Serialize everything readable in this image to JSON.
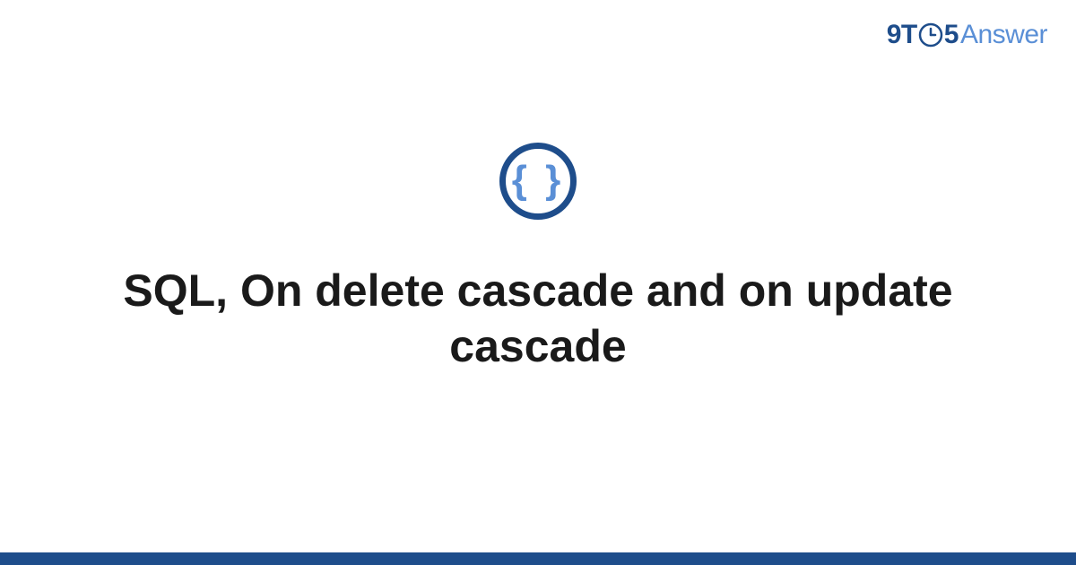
{
  "logo": {
    "part1": "9T",
    "part2": "5",
    "part3": "Answer"
  },
  "icon": {
    "braces": "{ }"
  },
  "title": "SQL, On delete cascade and on update cascade",
  "colors": {
    "primary": "#1e4d8b",
    "secondary": "#5a8fd6"
  }
}
